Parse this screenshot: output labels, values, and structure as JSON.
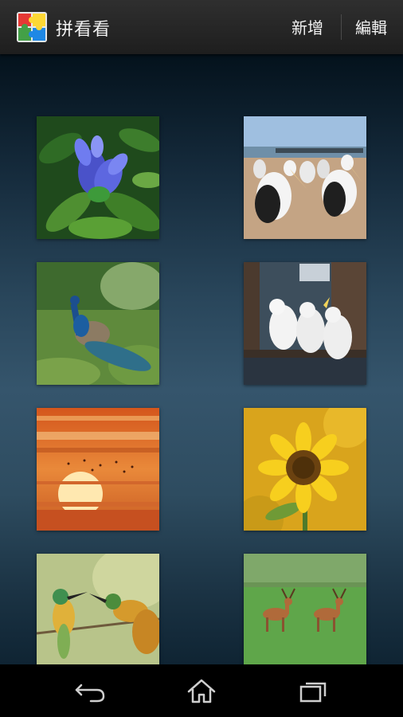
{
  "action_bar": {
    "app_title": "拼看看",
    "actions": {
      "add_label": "新增",
      "edit_label": "編輯"
    }
  },
  "puzzle_grid": {
    "items": [
      {
        "subject": "blue-flower",
        "icon": "image-thumbnail"
      },
      {
        "subject": "pelicans",
        "icon": "image-thumbnail"
      },
      {
        "subject": "peacock",
        "icon": "image-thumbnail"
      },
      {
        "subject": "cockatoos",
        "icon": "image-thumbnail"
      },
      {
        "subject": "sunset",
        "icon": "image-thumbnail"
      },
      {
        "subject": "sunflower",
        "icon": "image-thumbnail"
      },
      {
        "subject": "bee-eaters",
        "icon": "image-thumbnail"
      },
      {
        "subject": "deer",
        "icon": "image-thumbnail"
      }
    ]
  },
  "nav_bar": {
    "buttons": [
      "back-icon",
      "home-icon",
      "recent-apps-icon"
    ]
  }
}
